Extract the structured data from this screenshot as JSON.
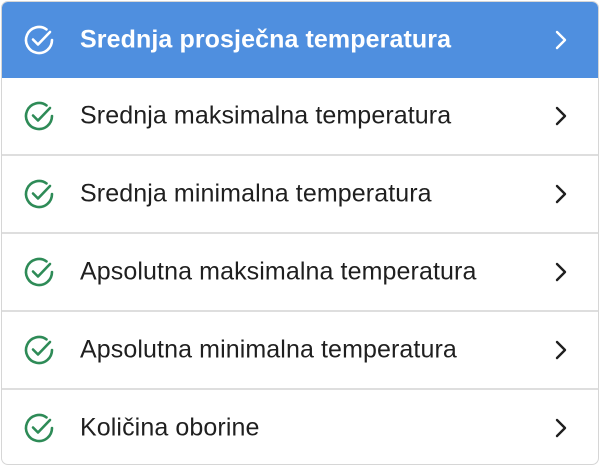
{
  "colors": {
    "active_bg": "#4f8fdf",
    "check_green": "#2e8b57",
    "active_fg": "#ffffff"
  },
  "menu": {
    "items": [
      {
        "label": "Srednja prosječna temperatura",
        "active": true,
        "icon": "check-circle-icon"
      },
      {
        "label": "Srednja maksimalna temperatura",
        "active": false,
        "icon": "check-circle-icon"
      },
      {
        "label": "Srednja minimalna temperatura",
        "active": false,
        "icon": "check-circle-icon"
      },
      {
        "label": "Apsolutna maksimalna temperatura",
        "active": false,
        "icon": "check-circle-icon"
      },
      {
        "label": "Apsolutna minimalna temperatura",
        "active": false,
        "icon": "check-circle-icon"
      },
      {
        "label": "Količina oborine",
        "active": false,
        "icon": "check-circle-icon"
      }
    ]
  }
}
